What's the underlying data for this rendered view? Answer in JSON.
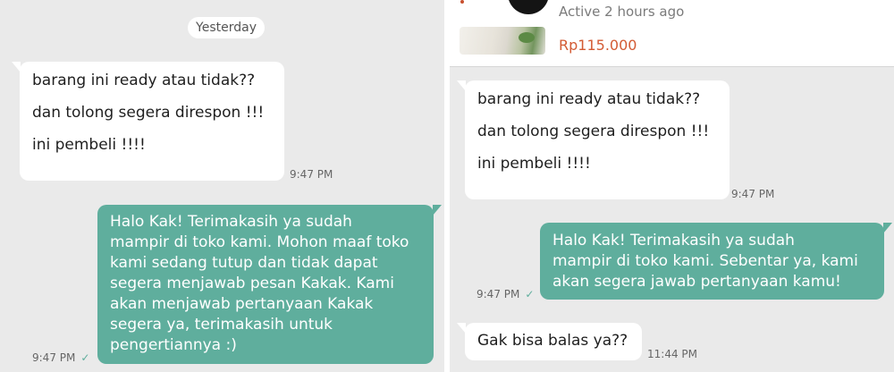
{
  "left": {
    "date_label": "Yesterday",
    "incoming": {
      "lines": [
        "barang ini ready atau tidak??",
        "dan tolong segera direspon !!!",
        "ini pembeli !!!!"
      ],
      "time": "9:47 PM"
    },
    "outgoing": {
      "text": "Halo Kak! Terimakasih ya sudah\nmampir di toko kami. Mohon maaf toko\nkami sedang tutup dan tidak dapat\nsegera menjawab pesan Kakak. Kami\nakan menjawab pertanyaan Kakak\nsegera ya, terimakasih untuk\npengertiannya :)",
      "time": "9:47 PM",
      "status_icon": "double-check-icon"
    }
  },
  "right": {
    "header": {
      "status": "Active 2 hours ago",
      "price": "Rp115.000",
      "price_color": "#d35b34"
    },
    "incoming": {
      "lines": [
        "barang ini ready atau tidak??",
        "dan tolong segera direspon !!!",
        "ini pembeli !!!!"
      ],
      "time": "9:47 PM"
    },
    "outgoing": {
      "text": "Halo Kak! Terimakasih ya sudah\nmampir di toko kami. Sebentar ya, kami\nakan segera jawab pertanyaan kamu!",
      "time": "9:47 PM",
      "status_icon": "double-check-icon"
    },
    "incoming_2": {
      "text": "Gak bisa balas ya??",
      "time": "11:44 PM"
    }
  },
  "colors": {
    "chat_background": "#eaeaea",
    "outgoing_bubble": "#5fae9d",
    "incoming_bubble": "#ffffff"
  }
}
